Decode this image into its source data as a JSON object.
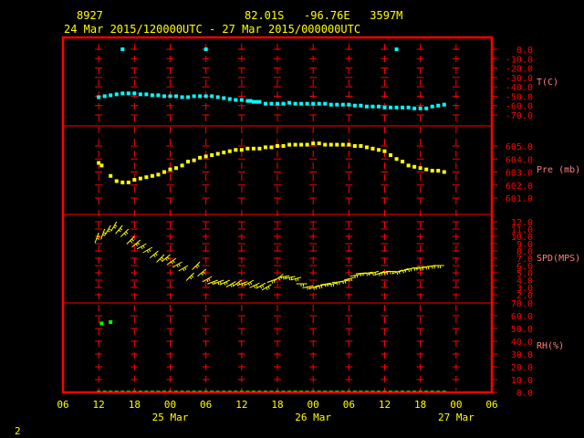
{
  "header": {
    "station_id": "8927",
    "location": "82.01S   -96.76E   3597M",
    "date_range": "24 Mar 2015/120000UTC - 27 Mar 2015/000000UTC"
  },
  "footer": {
    "page_number": "2"
  },
  "colors": {
    "frame": "#ff0000",
    "gridlines": "#ff0000",
    "tick_labels": "#ff0000",
    "axis_labels": "#ff7f7f",
    "header_text": "#ffff00",
    "temperature": "#00ffff",
    "pressure": "#ffff00",
    "wind": "#ffff00",
    "humidity": "#00ff00"
  },
  "chart_data": {
    "type": "scatter",
    "x_unit": "hours since 24 Mar 2015 00 UTC",
    "x_ticks": [
      6,
      12,
      18,
      24,
      30,
      36,
      42,
      48,
      54,
      60,
      66,
      72,
      78
    ],
    "x_tick_labels": [
      "06",
      "12",
      "18",
      "00",
      "06",
      "12",
      "18",
      "00",
      "06",
      "12",
      "18",
      "00",
      "06"
    ],
    "x_date_labels": [
      {
        "label": "25 Mar",
        "x": 24
      },
      {
        "label": "26 Mar",
        "x": 48
      },
      {
        "label": "27 Mar",
        "x": 72
      }
    ],
    "xlim": [
      6,
      78
    ],
    "grid": true,
    "panels": [
      {
        "name": "temperature",
        "label": "T(C)",
        "ylim": [
          -70,
          0
        ],
        "y_ticks": [
          0,
          -10,
          -20,
          -30,
          -40,
          -50,
          -60,
          -70
        ],
        "y_tick_labels": [
          "0.0",
          "-10.0",
          "-20.0",
          "-30.0",
          "-40.0",
          "-50.0",
          "-60.0",
          "-70.0"
        ],
        "x": [
          12,
          13,
          14,
          15,
          16,
          17,
          18,
          19,
          20,
          21,
          22,
          23,
          24,
          25,
          26,
          27,
          28,
          29,
          30,
          31,
          32,
          33,
          34,
          35,
          36,
          37,
          37.5,
          38,
          38.5,
          39,
          40,
          41,
          42,
          43,
          44,
          45,
          46,
          47,
          48,
          49,
          50,
          51,
          52,
          53,
          54,
          55,
          56,
          57,
          58,
          59,
          60,
          61,
          62,
          63,
          64,
          65,
          66,
          67,
          68,
          69,
          70
        ],
        "y": [
          -51,
          -50,
          -49,
          -48,
          -47,
          -47,
          -47,
          -48,
          -48,
          -49,
          -49,
          -50,
          -50,
          -50,
          -51,
          -51,
          -50,
          -50,
          -50,
          -50,
          -51,
          -52,
          -53,
          -54,
          -54,
          -55,
          -55,
          -56,
          -56,
          -56,
          -58,
          -58,
          -58,
          -58,
          -57,
          -58,
          -58,
          -58,
          -58,
          -58,
          -58,
          -59,
          -59,
          -59,
          -59,
          -60,
          -60,
          -61,
          -61,
          -61,
          -62,
          -62,
          -62,
          -62,
          -62,
          -63,
          -63,
          -63,
          -61,
          -60,
          -59
        ],
        "outliers_x": [
          16,
          30,
          62
        ],
        "outliers_y": [
          0,
          0,
          0
        ]
      },
      {
        "name": "pressure",
        "label": "Pre (mb)",
        "ylim": [
          601,
          605
        ],
        "y_ticks": [
          601,
          602,
          603,
          604,
          605
        ],
        "y_tick_labels": [
          "601.0",
          "602.0",
          "603.0",
          "604.0",
          "605.0"
        ],
        "x": [
          12,
          12.5,
          14,
          15,
          16,
          17,
          18,
          19,
          20,
          21,
          22,
          23,
          24,
          25,
          26,
          27,
          28,
          29,
          30,
          31,
          32,
          33,
          34,
          35,
          36,
          37,
          38,
          39,
          40,
          41,
          42,
          43,
          44,
          45,
          46,
          47,
          48,
          49,
          50,
          51,
          52,
          53,
          54,
          55,
          56,
          57,
          58,
          59,
          60,
          61,
          62,
          63,
          64,
          65,
          66,
          67,
          68,
          69,
          70
        ],
        "y": [
          603.7,
          603.5,
          602.7,
          602.3,
          602.2,
          602.2,
          602.4,
          602.5,
          602.6,
          602.7,
          602.8,
          603.0,
          603.2,
          603.3,
          603.5,
          603.8,
          603.9,
          604.1,
          604.2,
          604.3,
          604.4,
          604.5,
          604.6,
          604.7,
          604.7,
          604.8,
          604.8,
          604.8,
          604.9,
          604.9,
          605.0,
          605.0,
          605.1,
          605.1,
          605.1,
          605.1,
          605.2,
          605.2,
          605.1,
          605.1,
          605.1,
          605.1,
          605.1,
          605.0,
          605.0,
          604.9,
          604.8,
          604.7,
          604.6,
          604.3,
          604.0,
          603.8,
          603.5,
          603.4,
          603.3,
          603.2,
          603.1,
          603.1,
          603.0
        ],
        "bottom_edge_value": 601.0
      },
      {
        "name": "wind",
        "label": "SPD(MPS)",
        "ylim": [
          2,
          13
        ],
        "y_ticks": [
          2,
          3,
          4,
          5,
          6,
          7,
          8,
          9,
          10,
          11,
          12
        ],
        "y_tick_labels": [
          "2.0",
          "3.0",
          "4.0",
          "5.0",
          "6.0",
          "7.0",
          "8.0",
          "9.0",
          "10.0",
          "11.0",
          "12.0"
        ],
        "x": [
          12,
          13,
          14,
          15,
          16,
          17,
          18,
          19,
          20,
          21,
          22,
          23,
          24,
          25,
          26,
          27,
          28,
          29,
          30,
          31,
          32,
          33,
          34,
          35,
          36,
          37,
          38,
          39,
          40,
          41,
          42,
          43,
          44,
          45,
          46,
          47,
          48,
          49,
          50,
          51,
          52,
          53,
          54,
          55,
          56,
          57,
          58,
          59,
          60,
          61,
          62,
          63,
          64,
          65,
          66,
          67,
          68,
          69,
          70
        ],
        "y": [
          10.5,
          11.0,
          11.5,
          12.0,
          11.5,
          11.0,
          10.0,
          9.5,
          9.0,
          8.5,
          8.0,
          7.5,
          7.5,
          7.0,
          6.5,
          6.0,
          5.0,
          6.5,
          5.5,
          4.5,
          4.0,
          4.0,
          4.0,
          3.8,
          4.0,
          3.8,
          4.0,
          3.6,
          3.6,
          3.4,
          4.2,
          4.8,
          4.6,
          4.5,
          4.4,
          3.5,
          3.2,
          3.3,
          3.4,
          3.6,
          3.6,
          3.8,
          4.0,
          4.4,
          4.8,
          5.0,
          5.1,
          5.2,
          5.2,
          5.2,
          5.2,
          5.4,
          5.6,
          5.7,
          5.8,
          5.8,
          5.9,
          6.0,
          6.0
        ],
        "direction_deg": [
          70,
          70,
          60,
          60,
          50,
          45,
          45,
          40,
          30,
          30,
          40,
          45,
          40,
          35,
          30,
          30,
          45,
          45,
          40,
          30,
          20,
          20,
          25,
          30,
          35,
          20,
          30,
          25,
          30,
          30,
          20,
          35,
          10,
          10,
          15,
          0,
          10,
          20,
          15,
          10,
          10,
          5,
          10,
          15,
          10,
          5,
          10,
          15,
          20,
          10,
          0,
          20,
          20,
          15,
          10,
          10,
          5,
          5,
          0
        ]
      },
      {
        "name": "humidity",
        "label": "RH(%)",
        "ylim": [
          0,
          70
        ],
        "y_ticks": [
          0,
          10,
          20,
          30,
          40,
          50,
          60,
          70
        ],
        "y_tick_labels": [
          "0.0",
          "10.0",
          "20.0",
          "30.0",
          "40.0",
          "50.0",
          "60.0",
          "70.0"
        ],
        "x": [
          12.5,
          14
        ],
        "y": [
          54,
          55
        ],
        "zero_values_x_range": [
          12,
          70
        ]
      }
    ]
  }
}
